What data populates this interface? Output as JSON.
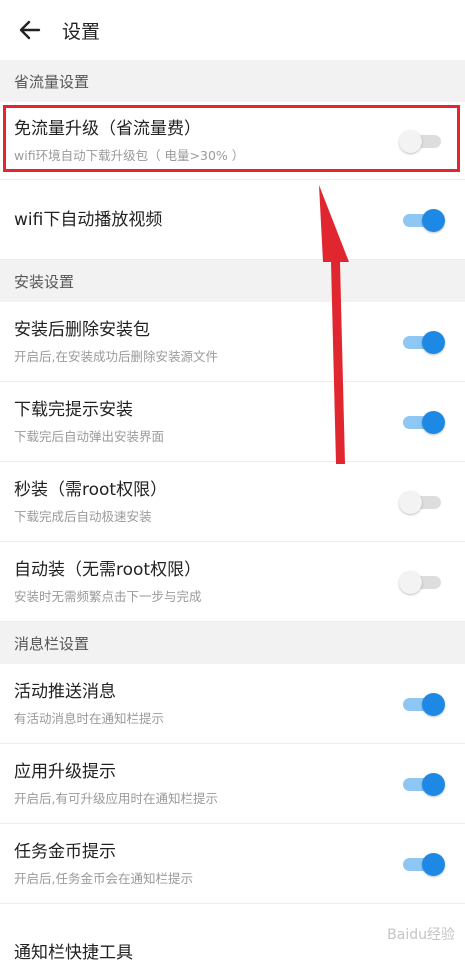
{
  "header": {
    "title": "设置",
    "back_icon": "arrow-left-icon"
  },
  "sections": [
    {
      "title": "省流量设置"
    },
    {
      "title": "安装设置"
    },
    {
      "title": "消息栏设置"
    }
  ],
  "settings": {
    "free_upgrade": {
      "label": "免流量升级（省流量费）",
      "sub": "wifi环境自动下载升级包（ 电量>30% ）",
      "on": false
    },
    "wifi_autoplay": {
      "label": "wifi下自动播放视频",
      "on": true
    },
    "delete_pkg": {
      "label": "安装后删除安装包",
      "sub": "开启后,在安装成功后删除安装源文件",
      "on": true
    },
    "prompt_install": {
      "label": "下载完提示安装",
      "sub": "下载完后自动弹出安装界面",
      "on": true
    },
    "quick_install": {
      "label": "秒装（需root权限）",
      "sub": "下载完成后自动极速安装",
      "on": false
    },
    "auto_install": {
      "label": "自动装（无需root权限）",
      "sub": "安装时无需频繁点击下一步与完成",
      "on": false
    },
    "push_msg": {
      "label": "活动推送消息",
      "sub": "有活动消息时在通知栏提示",
      "on": true
    },
    "upgrade_prompt": {
      "label": "应用升级提示",
      "sub": "开启后,有可升级应用时在通知栏提示",
      "on": true
    },
    "coin_prompt": {
      "label": "任务金币提示",
      "sub": "开启后,任务金币会在通知栏提示",
      "on": true
    }
  },
  "partial_row": {
    "label": "通知栏快捷工具"
  },
  "watermark": {
    "text": "Baidu经验"
  },
  "colors": {
    "accent": "#1e88e5",
    "highlight": "#e0272f"
  }
}
